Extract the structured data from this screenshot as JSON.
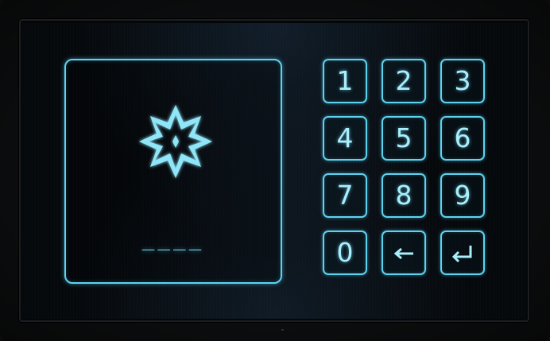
{
  "keypad": {
    "keys": [
      {
        "label": "1",
        "icon": null
      },
      {
        "label": "2",
        "icon": null
      },
      {
        "label": "3",
        "icon": null
      },
      {
        "label": "4",
        "icon": null
      },
      {
        "label": "5",
        "icon": null
      },
      {
        "label": "6",
        "icon": null
      },
      {
        "label": "7",
        "icon": null
      },
      {
        "label": "8",
        "icon": null
      },
      {
        "label": "9",
        "icon": null
      },
      {
        "label": "0",
        "icon": null
      },
      {
        "label": "",
        "icon": "backspace-arrow-icon"
      },
      {
        "label": "",
        "icon": "enter-arrow-icon"
      }
    ]
  },
  "display": {
    "emblem_icon": "compass-star-icon",
    "code": "____"
  },
  "colors": {
    "neon": "#5fd3ee",
    "text": "#a8eefc",
    "background": "#06090c"
  }
}
